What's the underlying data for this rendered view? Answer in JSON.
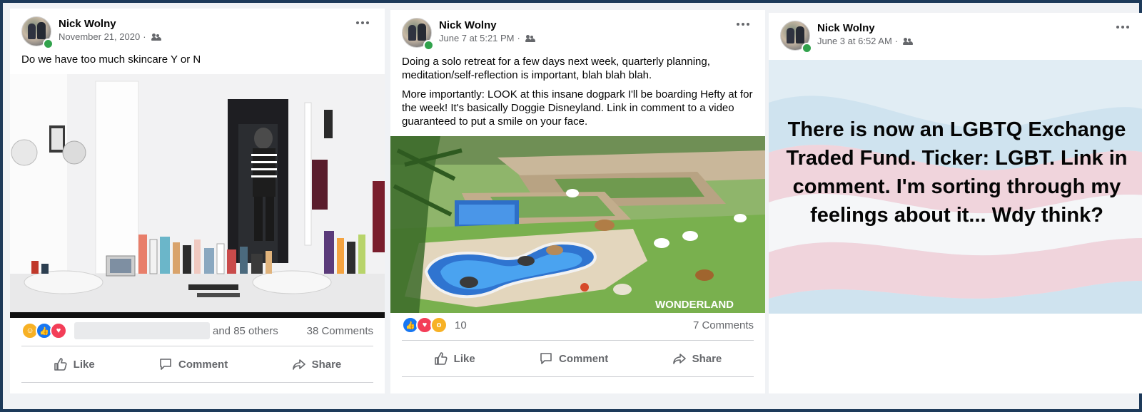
{
  "posts": [
    {
      "author": "Nick Wolny",
      "timestamp": "November 21, 2020",
      "audience_icon": "friends-icon",
      "text": [
        "Do we have too much skincare Y or N"
      ],
      "reactions": [
        "laugh",
        "like",
        "love"
      ],
      "reaction_text": "and 85 others",
      "comments": "38 Comments",
      "actions": {
        "like": "Like",
        "comment": "Comment",
        "share": "Share"
      }
    },
    {
      "author": "Nick Wolny",
      "timestamp": "June 7 at 5:21 PM",
      "audience_icon": "friends-icon",
      "text": [
        "Doing a solo retreat for a few days next week, quarterly planning, meditation/self-reflection is important, blah blah blah.",
        "More importantly: LOOK at this insane dogpark I'll be boarding Hefty at for the week! It's basically Doggie Disneyland. Link in comment to a video guaranteed to put a smile on your face."
      ],
      "image_watermark": "WONDERLAND",
      "reactions": [
        "like",
        "love",
        "wow"
      ],
      "reaction_count": "10",
      "comments": "7 Comments",
      "actions": {
        "like": "Like",
        "comment": "Comment",
        "share": "Share"
      }
    },
    {
      "author": "Nick Wolny",
      "timestamp": "June 3 at 6:52 AM",
      "audience_icon": "friends-icon",
      "card_text": "There is now an LGBTQ Exchange Traded Fund. Ticker: LGBT. Link in comment. I'm sorting through my feelings about it... Wdy think?"
    }
  ],
  "colors": {
    "like_blue": "#1877f2",
    "love_red": "#f33e58",
    "haha_yellow": "#f7b125",
    "online_green": "#31a24c"
  }
}
